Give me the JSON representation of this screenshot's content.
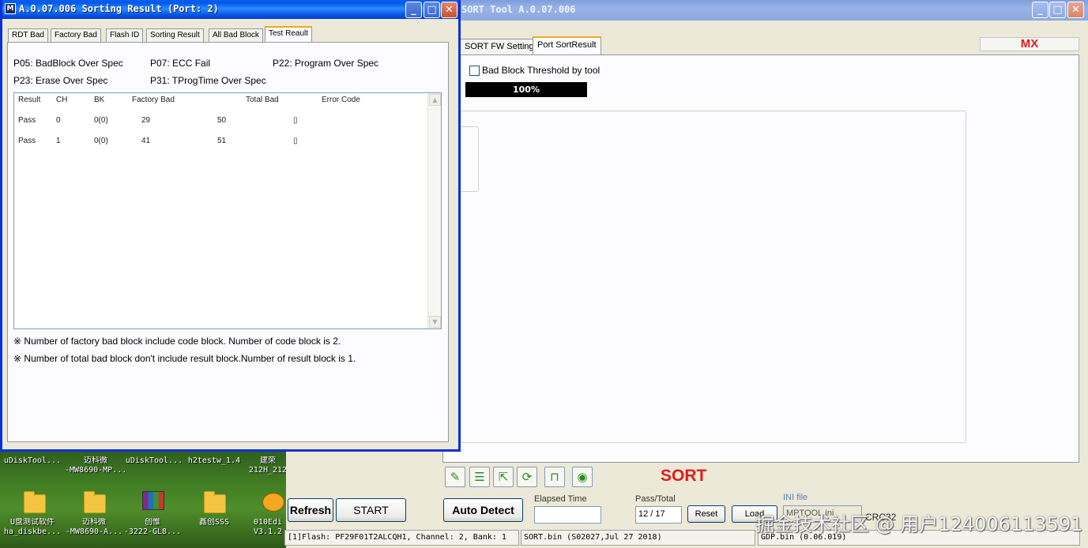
{
  "dialog": {
    "title": "A.0.07.006 Sorting Result  (Port: 2)",
    "icon_letter": "M",
    "tabs": [
      {
        "label": "RDT Bad"
      },
      {
        "label": "Factory Bad"
      },
      {
        "label": "Flash ID"
      },
      {
        "label": "Sorting Result"
      },
      {
        "label": "All Bad Block"
      },
      {
        "label": "Test Reault"
      }
    ],
    "codes": [
      {
        "text": "P05: BadBlock Over Spec"
      },
      {
        "text": "P07: ECC Fail"
      },
      {
        "text": "P22: Program Over Spec"
      },
      {
        "text": "P23: Erase Over Spec"
      },
      {
        "text": "P31: TProgTime Over Spec"
      }
    ],
    "table": {
      "columns": [
        "Result",
        "CH",
        "BK",
        "Factory Bad",
        "Total Bad",
        "Error Code"
      ],
      "rows": [
        [
          "Pass",
          "0",
          "0(0)",
          "29",
          "50",
          "▯"
        ],
        [
          "Pass",
          "1",
          "0(0)",
          "41",
          "51",
          "▯"
        ]
      ]
    },
    "notes": [
      {
        "symbol": "※",
        "text": "Number of factory bad block include code block. Number of code block is 2."
      },
      {
        "symbol": "※",
        "text": "Number of total bad block don't include result block.Number of result block is 1."
      }
    ],
    "caption_buttons": {
      "minimize": "_",
      "maximize": "□",
      "close": "✕"
    }
  },
  "main_window": {
    "title": "SORT Tool A.0.07.006",
    "caption_buttons": {
      "minimize": "_",
      "maximize": "□",
      "close": "✕"
    },
    "tabs": [
      {
        "label": "SORT FW Setting"
      },
      {
        "label": "Port SortResult"
      }
    ],
    "brand": "MX",
    "bad_block_threshold_label": "Bad Block Threshold by tool",
    "progress_text": "100%",
    "progress_value": 1.0,
    "sort_label": "SORT",
    "buttons": {
      "refresh": "Refresh",
      "start": "START",
      "auto_detect": "Auto Detect",
      "reset": "Reset",
      "load": "Load"
    },
    "elapsed_time_label": "Elapsed Time",
    "elapsed_time_value": "",
    "pass_total_label": "Pass/Total",
    "pass_total_value": "12 / 17",
    "ini_file_label": "INI file",
    "ini_file_value": "MPTOOL.ini",
    "crc_label": "CRC32",
    "status_bar": {
      "flash": "[1]Flash: PF29F01T2ALCQH1, Channel: 2, Bank: 1",
      "sort_bin": "SORT.bin (S02027,Jul 27 2018)",
      "gdp_bin": "GDP.bin (0.06.019)"
    },
    "toolbar_icons": [
      "pin-icon",
      "list-icon",
      "arrow-icon",
      "refresh-icon",
      "lock-icon",
      "stop-icon"
    ]
  },
  "desktop": {
    "top_labels": [
      "uDiskTool...",
      "迈科微\n-MW8690-MP...",
      "uDiskTool...",
      "h2testw_1.4",
      "建荣\n212H_212"
    ],
    "icons": [
      {
        "label": "U盘测试软件\nha_diskbe...",
        "icon": "folder-icon"
      },
      {
        "label": "迈科微\n-MW8690-A...",
        "icon": "folder-icon"
      },
      {
        "label": "创惟\n-3222-GL8...",
        "icon": "archive-icon"
      },
      {
        "label": "鑫创SSS",
        "icon": "folder-icon"
      },
      {
        "label": "010Edi\nV3.1.2",
        "icon": "hex-editor-icon"
      }
    ]
  },
  "watermark": "掘金技术社区 @ 用户124006113591"
}
